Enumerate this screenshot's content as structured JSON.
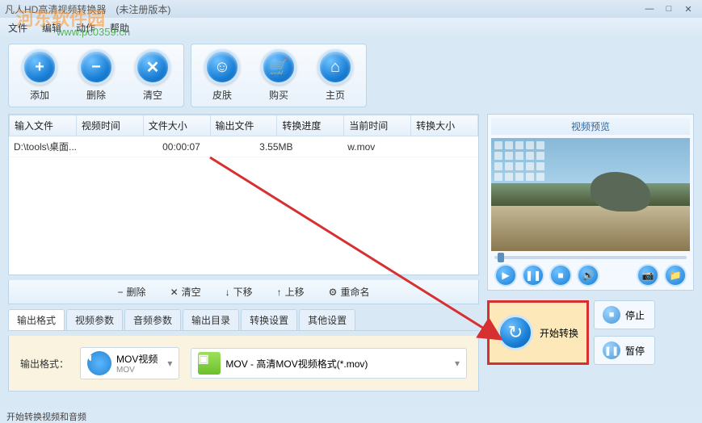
{
  "window": {
    "title": "凡人HD高清视频转换器　(未注册版本)"
  },
  "menu": {
    "file": "文件",
    "edit": "编辑",
    "action": "动作",
    "help": "帮助"
  },
  "watermark": {
    "text": "河东软件园",
    "url": "www.pc0359.cn"
  },
  "toolbar": {
    "add": "添加",
    "delete": "删除",
    "clear": "清空",
    "skin": "皮肤",
    "buy": "购买",
    "home": "主页"
  },
  "table": {
    "headers": {
      "input": "输入文件",
      "duration": "视频时间",
      "size": "文件大小",
      "output": "输出文件",
      "progress": "转换进度",
      "current": "当前时间",
      "outsize": "转换大小"
    },
    "rows": [
      {
        "input": "D:\\tools\\桌面...",
        "duration": "00:00:07",
        "size": "3.55MB",
        "output": "w.mov",
        "progress": "",
        "current": "",
        "outsize": ""
      }
    ],
    "actions": {
      "delete": "删除",
      "clear": "清空",
      "down": "下移",
      "up": "上移",
      "rename": "重命名"
    }
  },
  "tabs": {
    "format": "输出格式",
    "video": "视频参数",
    "audio": "音频参数",
    "dir": "输出目录",
    "convert": "转换设置",
    "other": "其他设置"
  },
  "output": {
    "label": "输出格式：",
    "mov_label": "MOV视频",
    "mov_sub": "MOV",
    "format_desc": "MOV - 高清MOV视频格式(*.mov)"
  },
  "preview": {
    "title": "视频预览"
  },
  "actions": {
    "start": "开始转换",
    "stop": "停止",
    "pause": "暂停"
  },
  "status": {
    "text": "开始转换视频和音频"
  }
}
